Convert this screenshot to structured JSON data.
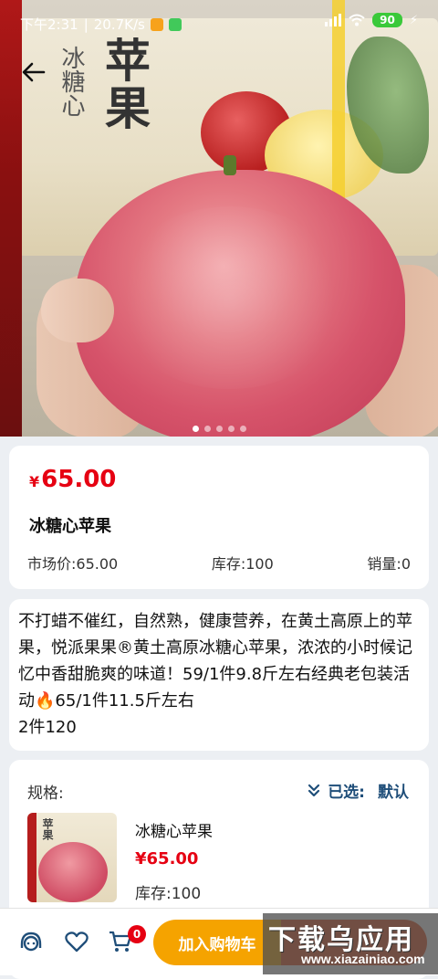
{
  "status_bar": {
    "time": "下午2:31",
    "speed": "20.7K/s",
    "battery": "90"
  },
  "hero": {
    "box_text": "冰糖心苹果",
    "carousel_total": 5,
    "carousel_active": 1
  },
  "product": {
    "currency": "¥",
    "price": "65.00",
    "name": "冰糖心苹果",
    "market_price": "市场价:65.00",
    "stock": "库存:100",
    "sales": "销量:0"
  },
  "description": "不打蜡不催红，自然熟，健康营养，在黄土高原上的苹果，悦派果果®黄土高原冰糖心苹果，浓浓的小时候记忆中香甜脆爽的味道！59/1件9.8斤左右经典老包装活动🔥65/1件11.5斤左右\n2件120",
  "spec": {
    "label": "规格:",
    "selected_label": "已选:",
    "selected_value": "默认",
    "sku_name": "冰糖心苹果",
    "sku_price": "¥65.00",
    "sku_stock": "库存:100"
  },
  "bottom_bar": {
    "cart_count": "0",
    "add_to_cart": "加入购物车"
  },
  "watermark": {
    "title": "下载乌应用",
    "url": "www.xiazainiao.com"
  },
  "colors": {
    "price_red": "#e60012",
    "accent_blue": "#1f4e79",
    "cart_orange": "#f5a300"
  }
}
